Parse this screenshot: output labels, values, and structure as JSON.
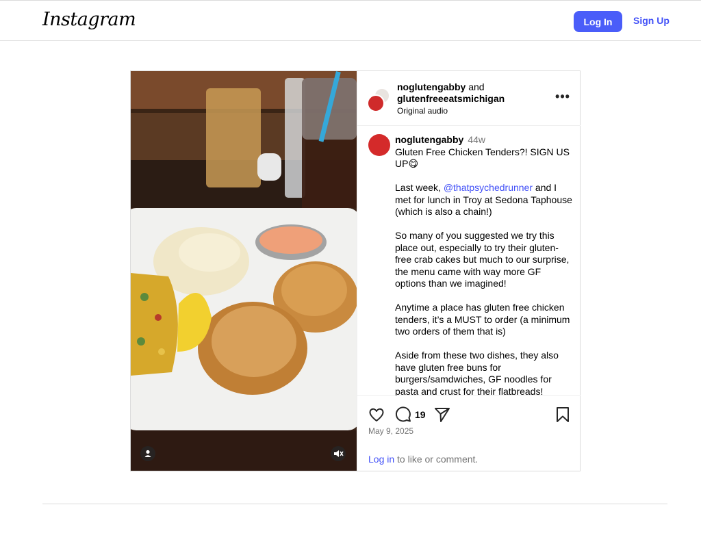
{
  "header": {
    "logo": "Instagram",
    "login_label": "Log In",
    "signup_label": "Sign Up"
  },
  "post": {
    "author": {
      "user1": "noglutengabby",
      "joiner": " and ",
      "user2": "glutenfreeeatsmichigan",
      "audio": "Original audio"
    },
    "caption": {
      "username": "noglutengabby",
      "age": "44w",
      "paragraphs": [
        "Gluten Free Chicken Tenders?! SIGN US UP😋",
        "So many of you suggested we try this place out, especially to try their gluten-free crab cakes but much to our surprise, the menu came with way more GF options than we imagined!",
        "Anytime a place has gluten free chicken tenders, it’s a MUST to order (a minimum two orders of them that is)",
        "Aside from these two dishes, they also have gluten free buns for burgers/samdwiches, GF noodles for pasta and crust for their flatbreads!"
      ],
      "p2_before": "Last week, ",
      "p2_mention": "@thatpsychedrunner",
      "p2_after": " and I met for lunch in Troy at Sedona Taphouse (which is also a chain!)"
    },
    "actions": {
      "comment_count": "19",
      "date": "May 9, 2025",
      "login_link": "Log in",
      "login_rest": " to like or comment."
    },
    "media": {
      "tag_icon": "person-icon",
      "mute_icon": "muted-speaker-icon"
    }
  },
  "colors": {
    "accent": "#4a5df9",
    "link": "#4150f7",
    "muted_text": "#737373",
    "border": "#dbdbdb"
  }
}
